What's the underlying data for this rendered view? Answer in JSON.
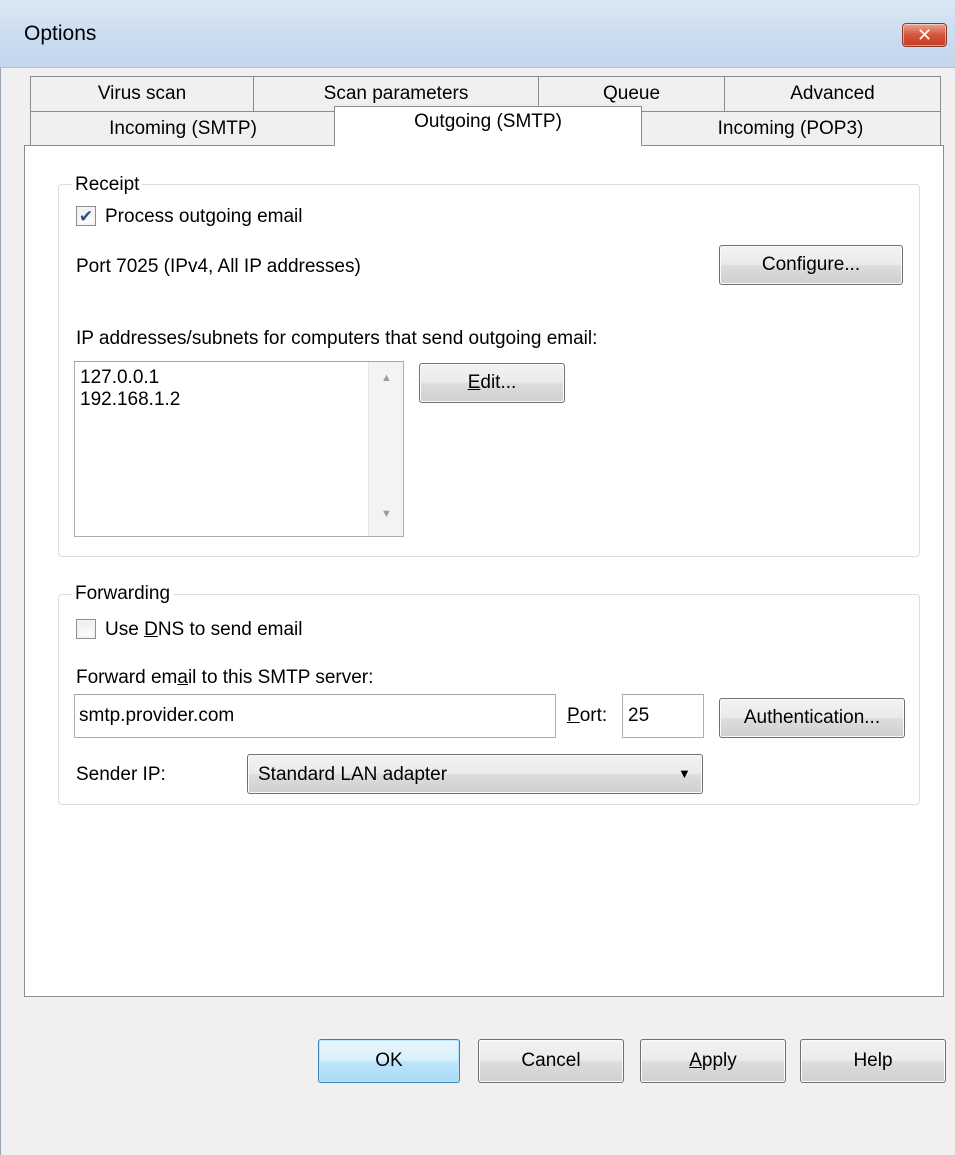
{
  "window": {
    "title": "Options",
    "close_glyph": "✕"
  },
  "tabs": {
    "row1": [
      {
        "label": "Virus scan"
      },
      {
        "label": "Scan parameters"
      },
      {
        "label": "Queue"
      },
      {
        "label": "Advanced"
      }
    ],
    "row2": [
      {
        "label": "Incoming (SMTP)"
      },
      {
        "label": "Outgoing (SMTP)",
        "selected": true
      },
      {
        "label": "Incoming (POP3)"
      }
    ]
  },
  "receipt": {
    "group_label": "Receipt",
    "process_checkbox": {
      "label": "Process outgoing email",
      "checked": true
    },
    "port_text": "Port 7025 (IPv4, All IP addresses)",
    "configure_button": "Configure...",
    "ip_list_label": "IP addresses/subnets for computers that send outgoing email:",
    "ip_list": [
      "127.0.0.1",
      "192.168.1.2"
    ],
    "edit_button": {
      "accel": "E",
      "rest": "dit..."
    }
  },
  "forwarding": {
    "group_label": "Forwarding",
    "dns_checkbox": {
      "pre": "Use ",
      "accel": "D",
      "post": "NS to send email",
      "checked": false
    },
    "server_label": {
      "pre": "Forward em",
      "accel": "a",
      "post": "il to this SMTP server:"
    },
    "server_value": "smtp.provider.com",
    "port_label": {
      "accel": "P",
      "post": "ort:"
    },
    "port_value": "25",
    "authentication_button": "Authentication...",
    "sender_ip_label": "Sender IP:",
    "sender_ip_selected": "Standard LAN adapter"
  },
  "footer": {
    "ok": "OK",
    "cancel": "Cancel",
    "apply": {
      "accel": "A",
      "post": "pply"
    },
    "help": "Help"
  },
  "icons": {
    "check": "✔",
    "dropdown": "▼",
    "scroll_up": "▲",
    "scroll_down": "▼"
  },
  "colors": {
    "title_bar": "#c9dbef",
    "close_button": "#d4553c",
    "panel": "#ffffff",
    "dialog_face": "#f0f0f0",
    "default_button": "#bee6fd"
  }
}
